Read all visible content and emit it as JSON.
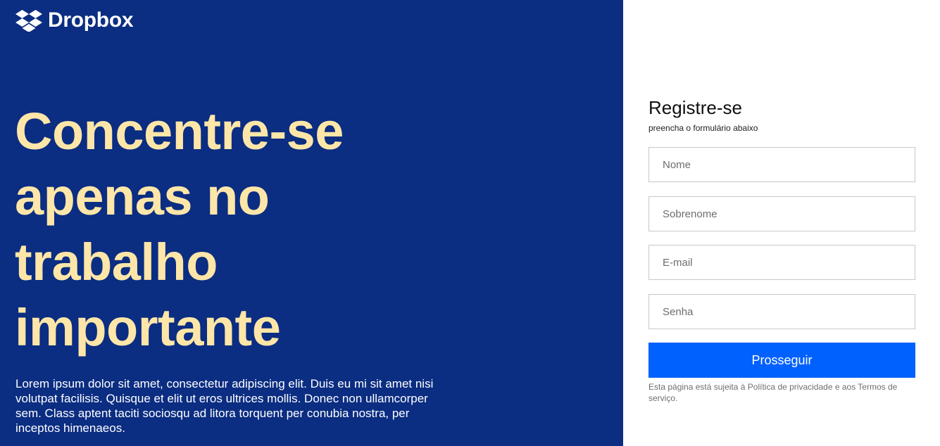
{
  "brand": {
    "name": "Dropbox",
    "bg_color": "#0b2d82",
    "accent_color": "#fde6a8",
    "logo_icon": "dropbox-logo-icon"
  },
  "hero": {
    "headline": "Concentre-se apenas no trabalho importante",
    "body": "Lorem ipsum dolor sit amet, consectetur adipiscing elit. Duis eu mi sit amet nisi volutpat facilisis. Quisque et elit ut eros ultrices mollis. Donec non ullamcorper sem. Class aptent taciti sociosqu ad litora torquent per conubia nostra, per inceptos himenaeos."
  },
  "form": {
    "title": "Registre-se",
    "subtitle": "preencha o formulário abaixo",
    "fields": {
      "first_name": {
        "placeholder": "Nome",
        "value": ""
      },
      "last_name": {
        "placeholder": "Sobrenome",
        "value": ""
      },
      "email": {
        "placeholder": "E-mail",
        "value": ""
      },
      "password": {
        "placeholder": "Senha",
        "value": ""
      }
    },
    "submit_label": "Prosseguir",
    "submit_color": "#0061fe",
    "terms": "Esta página está sujeita à Política de privacidade e aos Termos de serviço."
  }
}
